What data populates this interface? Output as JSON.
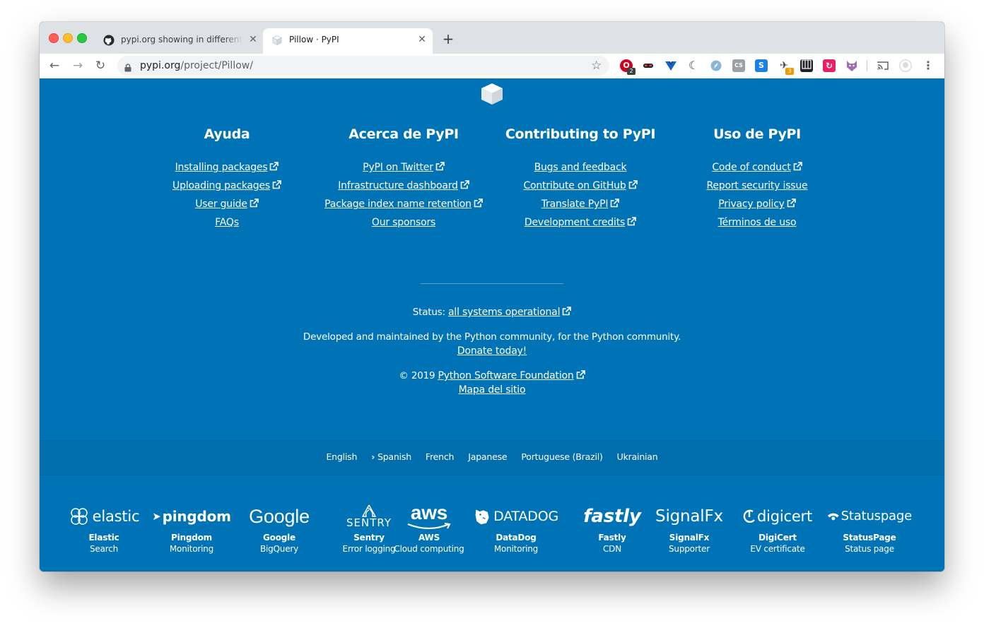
{
  "browser": {
    "tabs": [
      {
        "title": "pypi.org showing in different la",
        "active": false,
        "icon": "github-icon"
      },
      {
        "title": "Pillow · PyPI",
        "active": true,
        "icon": "pypi-icon"
      }
    ],
    "url_host": "pypi.org",
    "url_path": "/project/Pillow/",
    "extensions": [
      {
        "name": "opera-icon",
        "badge": "2"
      },
      {
        "name": "mask-icon"
      },
      {
        "name": "vue-icon"
      },
      {
        "name": "moon-icon"
      },
      {
        "name": "compass-icon"
      },
      {
        "name": "css-icon"
      },
      {
        "name": "s-icon"
      },
      {
        "name": "plane-icon",
        "badge": "3"
      },
      {
        "name": "columns-icon"
      },
      {
        "name": "refresh-icon"
      },
      {
        "name": "fox-icon"
      },
      {
        "name": "cast-icon"
      },
      {
        "name": "profile-icon"
      },
      {
        "name": "menu-icon"
      }
    ]
  },
  "footer": {
    "columns": [
      {
        "title": "Ayuda",
        "links": [
          {
            "label": "Installing packages",
            "external": true
          },
          {
            "label": "Uploading packages",
            "external": true
          },
          {
            "label": "User guide",
            "external": true
          },
          {
            "label": "FAQs",
            "external": false
          }
        ]
      },
      {
        "title": "Acerca de PyPI",
        "links": [
          {
            "label": "PyPI on Twitter",
            "external": true
          },
          {
            "label": "Infrastructure dashboard",
            "external": true
          },
          {
            "label": "Package index name retention",
            "external": true
          },
          {
            "label": "Our sponsors",
            "external": false
          }
        ]
      },
      {
        "title": "Contributing to PyPI",
        "links": [
          {
            "label": "Bugs and feedback",
            "external": false
          },
          {
            "label": "Contribute on GitHub",
            "external": true
          },
          {
            "label": "Translate PyPI",
            "external": true
          },
          {
            "label": "Development credits",
            "external": true
          }
        ]
      },
      {
        "title": "Uso de PyPI",
        "links": [
          {
            "label": "Code of conduct",
            "external": true
          },
          {
            "label": "Report security issue",
            "external": false
          },
          {
            "label": "Privacy policy",
            "external": true
          },
          {
            "label": "Términos de uso",
            "external": false
          }
        ]
      }
    ],
    "status_label": "Status:",
    "status_link": "all systems operational",
    "developed_text": "Developed and maintained by the Python community, for the Python community.",
    "donate_link": "Donate today!",
    "copyright": "© 2019",
    "psf_link": "Python Software Foundation",
    "sitemap_link": "Mapa del sitio"
  },
  "languages": {
    "current_marker": "›",
    "items": [
      "English",
      "Spanish",
      "French",
      "Japanese",
      "Portuguese (Brazil)",
      "Ukrainian"
    ],
    "current": "Spanish"
  },
  "sponsors": [
    {
      "logo_text": "elastic",
      "name": "Elastic",
      "role": "Search",
      "icon": "elastic-icon"
    },
    {
      "logo_text": "pingdom",
      "name": "Pingdom",
      "role": "Monitoring",
      "icon": "pingdom-icon"
    },
    {
      "logo_text": "Google",
      "name": "Google",
      "role": "BigQuery",
      "icon": "google-icon"
    },
    {
      "logo_text": "SENTRY",
      "name": "Sentry",
      "role": "Error logging",
      "icon": "sentry-icon"
    },
    {
      "logo_text": "aws",
      "name": "AWS",
      "role": "Cloud computing",
      "icon": "aws-icon"
    },
    {
      "logo_text": "DATADOG",
      "name": "DataDog",
      "role": "Monitoring",
      "icon": "datadog-icon"
    },
    {
      "logo_text": "fastly",
      "name": "Fastly",
      "role": "CDN",
      "icon": "fastly-icon"
    },
    {
      "logo_text": "SignalFx",
      "name": "SignalFx",
      "role": "Supporter",
      "icon": "signalfx-icon"
    },
    {
      "logo_text": "digicert",
      "name": "DigiCert",
      "role": "EV certificate",
      "icon": "digicert-icon"
    },
    {
      "logo_text": "Statuspage",
      "name": "StatusPage",
      "role": "Status page",
      "icon": "statuspage-icon"
    }
  ],
  "colors": {
    "page_background": "#0073b7",
    "tabstrip": "#dee1e6",
    "text": "#ffffff"
  }
}
